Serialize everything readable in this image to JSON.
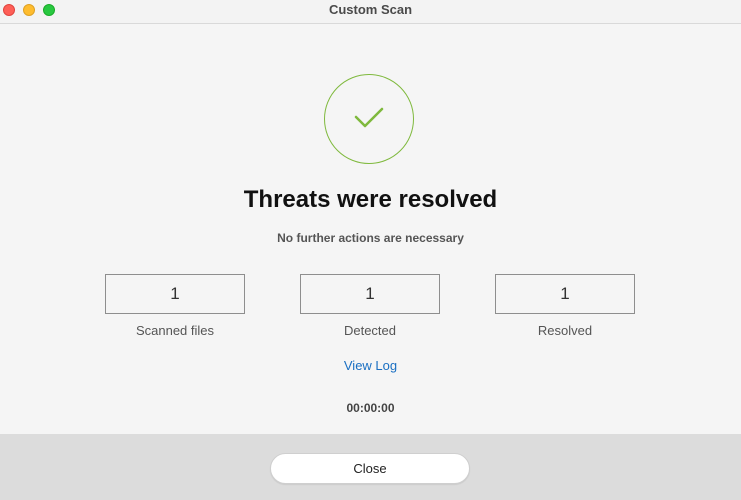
{
  "window": {
    "title": "Custom Scan"
  },
  "status": {
    "icon": "checkmark-icon",
    "color": "#7fb93d",
    "heading": "Threats were resolved",
    "subheading": "No further actions are necessary"
  },
  "stats": [
    {
      "value": "1",
      "label": "Scanned files"
    },
    {
      "value": "1",
      "label": "Detected"
    },
    {
      "value": "1",
      "label": "Resolved"
    }
  ],
  "links": {
    "view_log": "View Log"
  },
  "timer": "00:00:00",
  "footer": {
    "close_label": "Close"
  },
  "colors": {
    "link": "#1a6fc2",
    "success": "#7fb93d"
  }
}
